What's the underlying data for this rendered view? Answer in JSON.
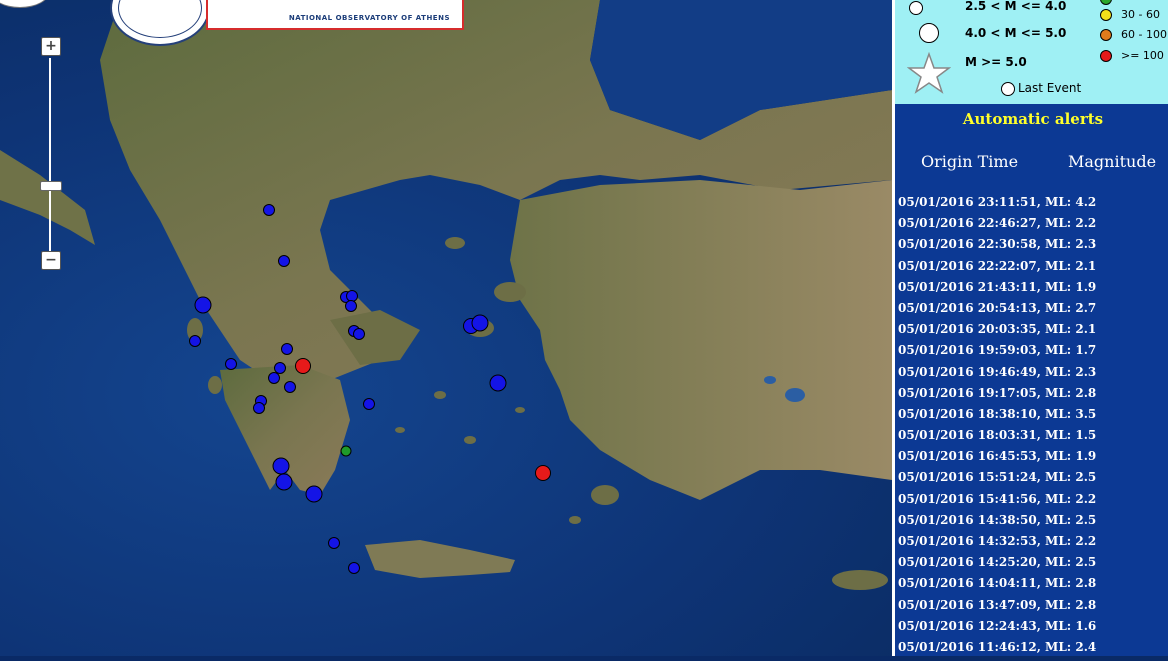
{
  "header": {
    "org_text": "NATIONAL OBSERVATORY OF ATHENS"
  },
  "map_controls": {
    "zoom_in": "+",
    "zoom_out": "−",
    "zoom_mid": "−"
  },
  "legend": {
    "magnitudes": [
      {
        "label": "2.5 < M <= 4.0"
      },
      {
        "label": "4.0 < M <= 5.0"
      },
      {
        "label": "M >= 5.0"
      }
    ],
    "age_ranges": [
      {
        "label": "30 - 60",
        "color": "#f2e11a"
      },
      {
        "label": "60 - 100",
        "color": "#e07b1c"
      },
      {
        "label": ">= 100",
        "color": "#e61a1a"
      }
    ],
    "partial_color": "#2aa52a",
    "last_event": "Last Event"
  },
  "alerts": {
    "title": "Automatic alerts",
    "col_time": "Origin Time",
    "col_mag": "Magnitude",
    "events": [
      "05/01/2016  23:11:51,   ML: 4.2",
      "05/01/2016  22:46:27,   ML: 2.2",
      "05/01/2016  22:30:58,   ML: 2.3",
      "05/01/2016  22:22:07,   ML: 2.1",
      "05/01/2016  21:43:11,   ML: 1.9",
      "05/01/2016  20:54:13,   ML: 2.7",
      "05/01/2016  20:03:35,   ML: 2.1",
      "05/01/2016  19:59:03,   ML: 1.7",
      "05/01/2016  19:46:49,   ML: 2.3",
      "05/01/2016  19:17:05,   ML: 2.8",
      "05/01/2016  18:38:10,   ML: 3.5",
      "05/01/2016  18:03:31,   ML: 1.5",
      "05/01/2016  16:45:53,   ML: 1.9",
      "05/01/2016  15:51:24,   ML: 2.5",
      "05/01/2016  15:41:56,   ML: 2.2",
      "05/01/2016  14:38:50,   ML: 2.5",
      "05/01/2016  14:32:53,   ML: 2.2",
      "05/01/2016  14:25:20,   ML: 2.5",
      "05/01/2016  14:04:11,   ML: 2.8",
      "05/01/2016  13:47:09,   ML: 2.8",
      "05/01/2016  12:24:43,   ML: 1.6",
      "05/01/2016  11:46:12,   ML: 2.4"
    ]
  },
  "colors": {
    "event_blue": "#1414e6",
    "event_red": "#e61a1a",
    "event_green": "#1f9a2a"
  }
}
